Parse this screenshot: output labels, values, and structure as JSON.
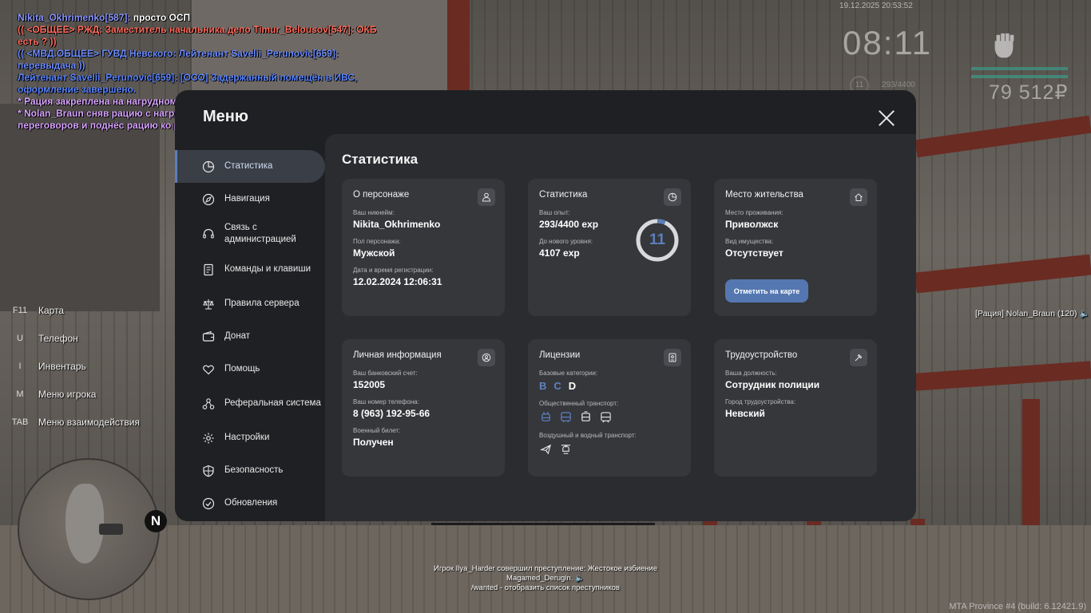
{
  "chat": [
    {
      "color": "#8a96ff",
      "parts": [
        {
          "text": "Nikita_Okhrimenko[587]:",
          "color": "#8a96ff"
        },
        {
          "text": " просто ОСП",
          "color": "#ffffff"
        }
      ]
    },
    {
      "color": "#ff6c5e",
      "parts": [
        {
          "text": "(( <ОБЩЕЕ> РЖД: Заместитель начальника депо Timur_Belousov[547]: ОКБ есть ? ))",
          "color": "#ff6c5e"
        }
      ]
    },
    {
      "color": "#6c8cff",
      "parts": [
        {
          "text": "(( <МВД.ОБЩЕЕ> ГУВД Невского: Лейтенант Savelii_Perunovic[659]: перевыдача ))",
          "color": "#6c8cff"
        }
      ]
    },
    {
      "color": "#5a84ff",
      "parts": [
        {
          "text": "Лейтенант Savelii_Perunovic[659]: [ОСО] Задержанный помещён в ИВС, оформление завершено.",
          "color": "#5a84ff"
        }
      ]
    },
    {
      "color": "#d9a4ff",
      "parts": [
        {
          "text": "* Рация закреплена на нагрудном кармане. (Nolan_Braun)",
          "color": "#d9a4ff"
        }
      ]
    },
    {
      "color": "#d9a4ff",
      "parts": [
        {
          "text": "* Nolan_Braun сняв рацию с нагрудного кармана, зажал кнопку для переговоров и поднёс рацию ко рту",
          "color": "#d9a4ff"
        }
      ]
    }
  ],
  "hud": {
    "date": "19.12.2025 20:53:52",
    "clock": "08:11",
    "money": "79 512₽",
    "level": "11",
    "exp": "293/4400"
  },
  "hotkeys": [
    {
      "key": "F11",
      "label": "Карта"
    },
    {
      "key": "U",
      "label": "Телефон"
    },
    {
      "key": "I",
      "label": "Инвентарь"
    },
    {
      "key": "M",
      "label": "Меню игрока"
    },
    {
      "key": "TAB",
      "label": "Меню взаимодействия"
    }
  ],
  "compass": "N",
  "radio_label": "[Рация] Nolan_Braun (120)",
  "notification": {
    "line1": "Игрок Ilya_Harder совершил преступление: Жестокое избиение",
    "line2": "Magamed_Derugin.",
    "line3": "/wanted - отобразить список преступников"
  },
  "build": "MTA Province #4 (build: 6.12421.9)",
  "menu": {
    "title": "Меню",
    "section_title": "Статистика",
    "nav": [
      {
        "label": "Статистика",
        "icon": "stats-icon",
        "active": true
      },
      {
        "label": "Навигация",
        "icon": "compass-icon"
      },
      {
        "label": "Связь с администрацией",
        "icon": "headset-icon"
      },
      {
        "label": "Команды и клавиши",
        "icon": "document-icon"
      },
      {
        "label": "Правила сервера",
        "icon": "scales-icon"
      },
      {
        "label": "Донат",
        "icon": "wallet-icon"
      },
      {
        "label": "Помощь",
        "icon": "heart-hand-icon"
      },
      {
        "label": "Реферальная система",
        "icon": "referral-icon"
      },
      {
        "label": "Настройки",
        "icon": "gear-icon"
      },
      {
        "label": "Безопасность",
        "icon": "shield-icon"
      },
      {
        "label": "Обновления",
        "icon": "update-icon"
      }
    ]
  },
  "cards": {
    "character": {
      "title": "О персонаже",
      "nickname_label": "Ваш никнейм:",
      "nickname": "Nikita_Okhrimenko",
      "gender_label": "Пол персонажа:",
      "gender": "Мужской",
      "reg_label": "Дата и время регистрации:",
      "reg": "12.02.2024 12:06:31"
    },
    "stats": {
      "title": "Статистика",
      "exp_label": "Ваш опыт:",
      "exp": "293/4400 exp",
      "next_label": "До нового уровня:",
      "next": "4107 exp",
      "level": "11",
      "level_progress": 0.0666
    },
    "residence": {
      "title": "Место жительства",
      "place_label": "Место проживания:",
      "place": "Приволжск",
      "property_label": "Вид имущества:",
      "property": "Отсутствует",
      "map_button": "Отметить на карте"
    },
    "personal": {
      "title": "Личная информация",
      "bank_label": "Ваш банковский счет:",
      "bank": "152005",
      "phone_label": "Ваш номер телефона:",
      "phone": "8 (963) 192-95-66",
      "military_label": "Военный билет:",
      "military": "Получен"
    },
    "licenses": {
      "title": "Лицензии",
      "base_label": "Базовые категории:",
      "categories": [
        {
          "letter": "B",
          "active": true
        },
        {
          "letter": "C",
          "active": true
        },
        {
          "letter": "D",
          "active": false
        }
      ],
      "public_label": "Общественный транспорт:",
      "public_icons": [
        "trolleybus-icon",
        "bus-icon",
        "tram-icon",
        "train-icon"
      ],
      "air_label": "Воздушный и водный транспорт:",
      "air_icons": [
        "plane-icon",
        "helicopter-icon"
      ]
    },
    "job": {
      "title": "Трудоустройство",
      "position_label": "Ваша должность:",
      "position": "Сотрудник полиции",
      "city_label": "Город трудоустройства:",
      "city": "Невский"
    }
  },
  "colors": {
    "accent": "#5477b1",
    "panel": "#1f2023",
    "content": "#2b2c30",
    "card": "#36373b"
  }
}
